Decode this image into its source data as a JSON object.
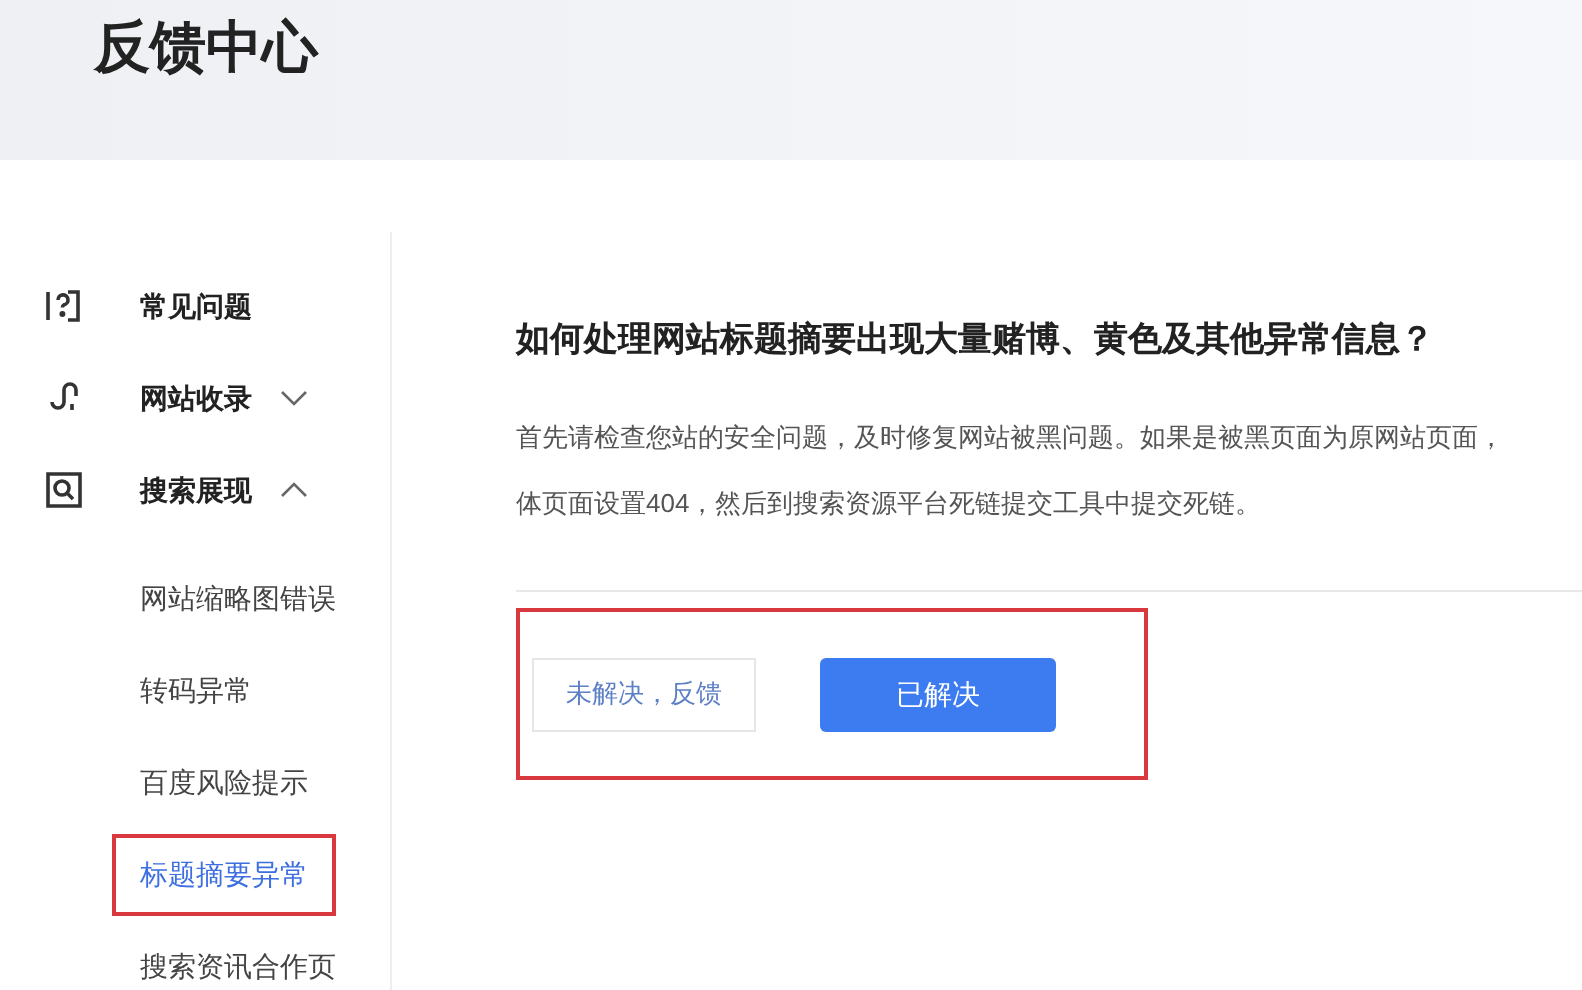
{
  "header": {
    "title": "反馈中心"
  },
  "sidebar": {
    "items": [
      {
        "label": "常见问题",
        "kind": "faq"
      },
      {
        "label": "网站收录",
        "kind": "index",
        "expanded": false
      },
      {
        "label": "搜索展现",
        "kind": "search",
        "expanded": true,
        "children": [
          {
            "label": "网站缩略图错误",
            "selected": false,
            "highlighted": false
          },
          {
            "label": "转码异常",
            "selected": false,
            "highlighted": false
          },
          {
            "label": "百度风险提示",
            "selected": false,
            "highlighted": false
          },
          {
            "label": "标题摘要异常",
            "selected": true,
            "highlighted": true
          },
          {
            "label": "搜索资讯合作页",
            "selected": false,
            "highlighted": false
          }
        ]
      }
    ]
  },
  "article": {
    "title": "如何处理网站标题摘要出现大量赌博、黄色及其他异常信息？",
    "lines": [
      "首先请检查您站的安全问题，及时修复网站被黑问题。如果是被黑页面为原网站页面，",
      "体页面设置404，然后到搜索资源平台死链提交工具中提交死链。"
    ]
  },
  "feedback": {
    "highlighted": true,
    "buttons": [
      {
        "label": "未解决，反馈",
        "kind": "secondary"
      },
      {
        "label": "已解决",
        "kind": "primary"
      }
    ]
  }
}
